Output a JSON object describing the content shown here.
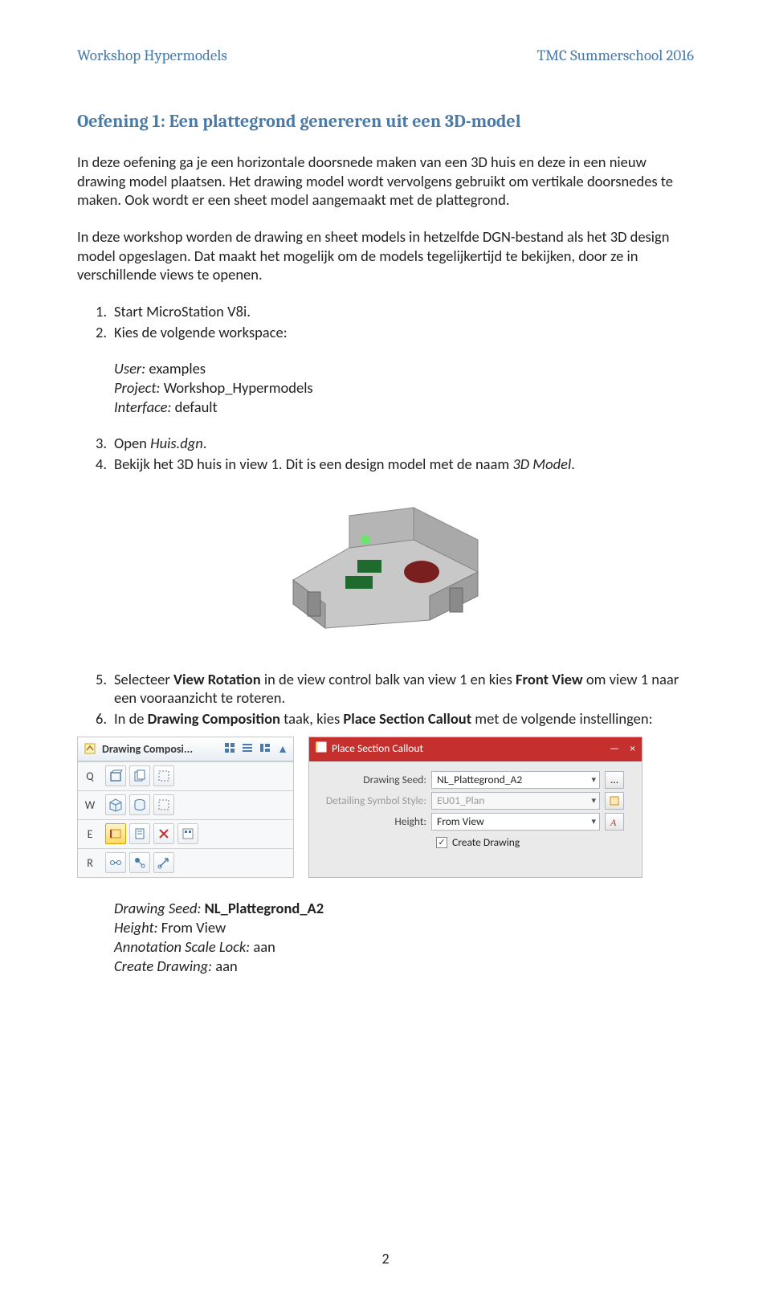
{
  "header": {
    "left": "Workshop Hypermodels",
    "right": "TMC Summerschool 2016"
  },
  "title": "Oefening 1: Een plattegrond genereren uit een 3D-model",
  "para1": "In deze oefening ga je een horizontale doorsnede maken van een 3D huis en deze in een nieuw drawing model plaatsen. Het drawing model wordt vervolgens gebruikt om vertikale doorsnedes te maken. Ook wordt er een sheet model aangemaakt met de plattegrond.",
  "para2": "In deze workshop worden de drawing en sheet models in hetzelfde DGN-bestand als het 3D design model opgeslagen. Dat maakt het mogelijk om de models tegelijkertijd te bekijken, door ze in verschillende views te openen.",
  "list1": {
    "i1": {
      "n": "1.",
      "t": "Start MicroStation V8i."
    },
    "i2": {
      "n": "2.",
      "t": "Kies de volgende workspace:"
    }
  },
  "workspace": {
    "user_lbl": "User:",
    "user_val": "examples",
    "project_lbl": "Project:",
    "project_val": "Workshop_Hypermodels",
    "iface_lbl": "Interface:",
    "iface_val": "default"
  },
  "list2": {
    "i3": {
      "n": "3.",
      "pre": "Open ",
      "em": "Huis.dgn",
      "post": "."
    },
    "i4": {
      "n": "4.",
      "pre": "Bekijk het 3D huis in view 1. Dit is een design model met de naam ",
      "em": "3D Model",
      "post": "."
    }
  },
  "list3": {
    "i5": {
      "n": "5.",
      "a": "Selecteer ",
      "b": "View Rotation",
      "c": " in de view control balk van view 1 en kies ",
      "d": "Front View",
      "e": " om view 1 naar een vooraanzicht te roteren."
    },
    "i6": {
      "n": "6.",
      "a": "In de ",
      "b": "Drawing Composition",
      "c": " taak, kies ",
      "d": "Place Section Callout",
      "e": " met de volgende instellingen:"
    }
  },
  "dc": {
    "title": "Drawing Composi...",
    "rows": {
      "q": "Q",
      "w": "W",
      "e": "E",
      "r": "R"
    }
  },
  "psc": {
    "title": "Place Section Callout",
    "close": "×",
    "rows": {
      "seed_lbl": "Drawing Seed:",
      "seed_val": "NL_Plattegrond_A2",
      "style_lbl": "Detailing Symbol Style:",
      "style_val": "EU01_Plan",
      "height_lbl": "Height:",
      "height_val": "From View"
    },
    "check_label": "Create Drawing"
  },
  "final": {
    "l1a": "Drawing Seed:",
    "l1b": "NL_Plattegrond_A2",
    "l2a": "Height:",
    "l2b": "From View",
    "l3a": "Annotation Scale Lock:",
    "l3b": "aan",
    "l4a": "Create Drawing:",
    "l4b": "aan"
  },
  "page": "2"
}
